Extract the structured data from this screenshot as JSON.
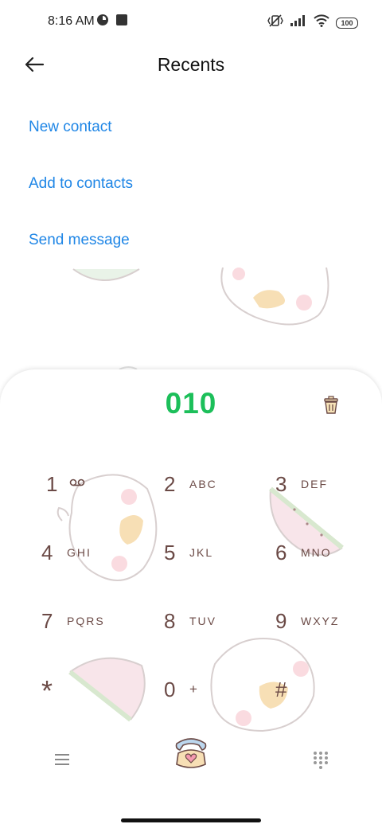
{
  "status_bar": {
    "time": "8:16 AM",
    "battery": "100",
    "icons": [
      "location-icon",
      "notification-square-icon",
      "vibrate-off-icon",
      "signal-icon",
      "wifi-icon",
      "battery-icon"
    ]
  },
  "header": {
    "title": "Recents",
    "back_icon": "back-arrow-icon"
  },
  "actions": {
    "new_contact": "New contact",
    "add_to_contacts": "Add to contacts",
    "send_message": "Send message"
  },
  "colors": {
    "accent_link": "#1f86e6",
    "dialed_number": "#1cbf5a",
    "key_text": "#6b4a46"
  },
  "dialer": {
    "number": "010",
    "delete_icon": "trash-icon",
    "keys": [
      {
        "digit": "1",
        "letters": "",
        "icon": "voicemail-icon"
      },
      {
        "digit": "2",
        "letters": "ABC"
      },
      {
        "digit": "3",
        "letters": "DEF"
      },
      {
        "digit": "4",
        "letters": "GHI"
      },
      {
        "digit": "5",
        "letters": "JKL"
      },
      {
        "digit": "6",
        "letters": "MNO"
      },
      {
        "digit": "7",
        "letters": "PQRS"
      },
      {
        "digit": "8",
        "letters": "TUV"
      },
      {
        "digit": "9",
        "letters": "WXYZ"
      },
      {
        "digit": "*",
        "letters": ""
      },
      {
        "digit": "0",
        "letters": "+"
      },
      {
        "digit": "#",
        "letters": ""
      }
    ],
    "bottom": {
      "menu_icon": "menu-icon",
      "call_icon": "phone-call-icon",
      "keypad_icon": "keypad-icon"
    }
  }
}
